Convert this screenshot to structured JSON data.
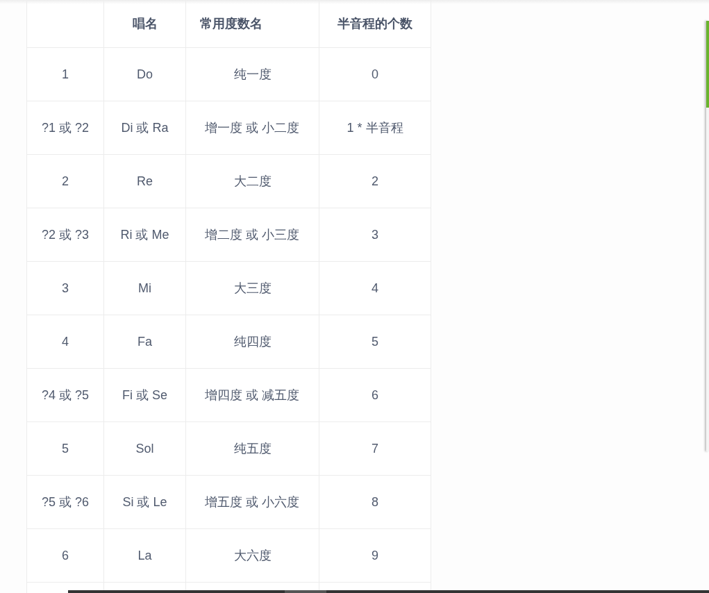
{
  "table": {
    "columns": [
      "",
      "唱名",
      "常用度数名",
      "半音程的个数"
    ],
    "rows": [
      [
        "1",
        "Do",
        "纯一度",
        "0"
      ],
      [
        "?1 或 ?2",
        "Di 或 Ra",
        "增一度 或 小二度",
        "1 * 半音程"
      ],
      [
        "2",
        "Re",
        "大二度",
        "2"
      ],
      [
        "?2 或 ?3",
        "Ri 或 Me",
        "增二度 或 小三度",
        "3"
      ],
      [
        "3",
        "Mi",
        "大三度",
        "4"
      ],
      [
        "4",
        "Fa",
        "纯四度",
        "5"
      ],
      [
        "?4 或 ?5",
        "Fi 或 Se",
        "增四度 或 减五度",
        "6"
      ],
      [
        "5",
        "Sol",
        "纯五度",
        "7"
      ],
      [
        "?5 或 ?6",
        "Si 或 Le",
        "增五度 或 小六度",
        "8"
      ],
      [
        "6",
        "La",
        "大六度",
        "9"
      ]
    ]
  }
}
